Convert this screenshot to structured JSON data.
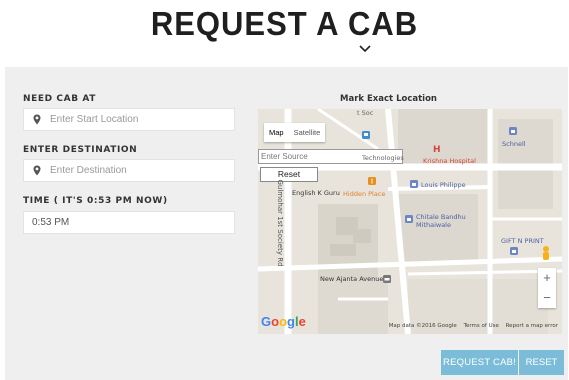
{
  "page": {
    "title": "REQUEST A CAB"
  },
  "form": {
    "pickup_label": "NEED CAB AT",
    "pickup_placeholder": "Enter Start Location",
    "destination_label": "ENTER DESTINATION",
    "destination_placeholder": "Enter Destination",
    "time_label": "TIME ( IT'S 0:53 PM NOW)",
    "time_value": "0:53 PM"
  },
  "map": {
    "title": "Mark Exact Location",
    "map_type_active": "Map",
    "map_type_alt": "Satellite",
    "source_placeholder": "Enter Source",
    "reset_label": "Reset",
    "places": {
      "hospital_marker": "H",
      "hospital": "Krishna Hospital",
      "schnell": "Schnell",
      "louis": "Louis Philippe",
      "chitale_1": "Chitale Bandhu",
      "chitale_2": "Mithaiwale",
      "gift": "GIFT N PRINT",
      "english_guru": "English K Guru",
      "hidden_place": "Hidden Place",
      "ajanta": "New Ajanta Avenue",
      "road": "Gulmohar 1st Society Rd",
      "partial_top": "t Soc",
      "partial_tech": "Technologies P..."
    },
    "zoom_in": "+",
    "zoom_out": "−",
    "google": "Google",
    "attribution": [
      "Map data ©2016 Google",
      "Terms of Use",
      "Report a map error"
    ]
  },
  "actions": {
    "request_label": "REQUEST CAB!",
    "reset_label": "RESET"
  },
  "colors": {
    "button_bg": "#7bbdd9",
    "panel_bg": "#efefef"
  }
}
